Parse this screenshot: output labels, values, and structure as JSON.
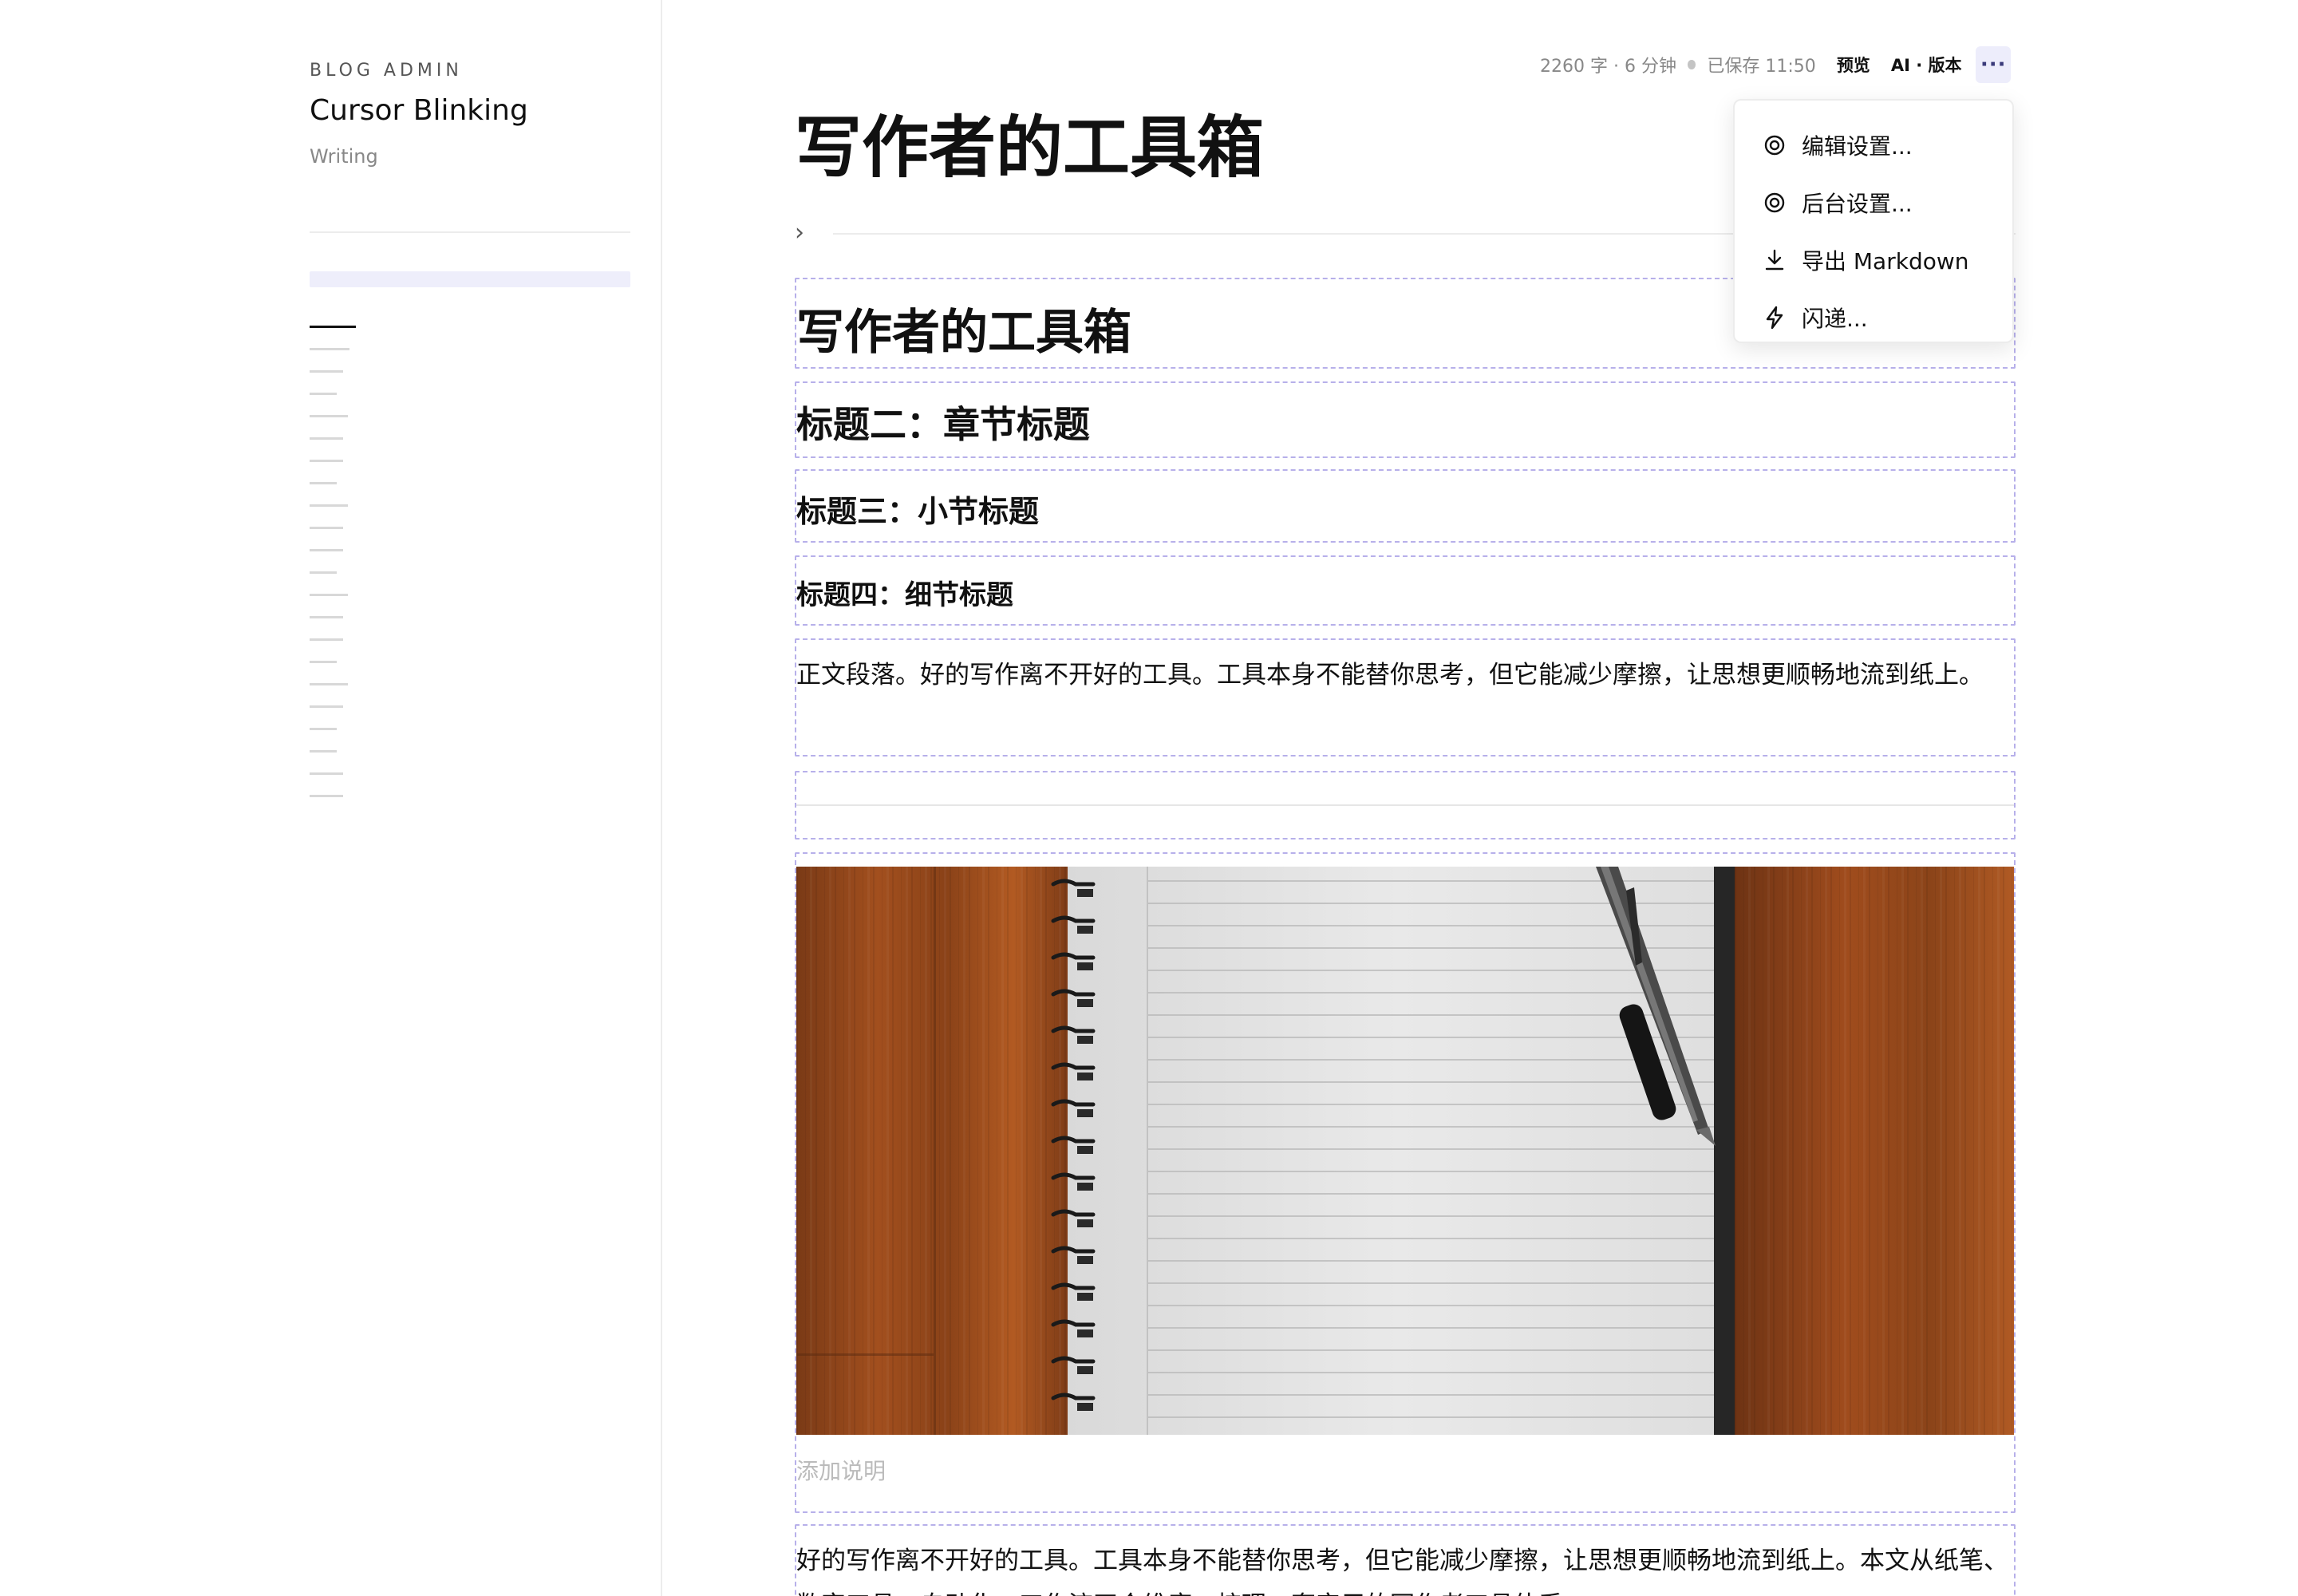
{
  "sidebar": {
    "eyebrow": "BLOG ADMIN",
    "title": "Cursor Blinking",
    "subtitle": "Writing"
  },
  "topbar": {
    "word_count": "2260 字 · 6 分钟",
    "saved": "已保存 11:50",
    "preview_label": "预览",
    "ai_version_label": "AI · 版本",
    "more_label": "···",
    "status_color": "#c4c4c4",
    "accent": "#ededfb"
  },
  "editor": {
    "doc_title": "写作者的工具箱",
    "h1": "写作者的工具箱",
    "h2": "标题二：章节标题",
    "h3": "标题三：小节标题",
    "h4": "标题四：细节标题",
    "paragraph": "正文段落。好的写作离不开好的工具。工具本身不能替你思考，但它能减少摩擦，让思想更顺畅地流到纸上。",
    "image_caption_placeholder": "添加说明",
    "paragraph2": "好的写作离不开好的工具。工具本身不能替你思考，但它能减少摩擦，让思想更顺畅地流到纸上。本文从纸笔、数字工具、自动化、工作流四个维度，梳理一套实用的写作者工具体系。"
  },
  "menu": {
    "items": [
      {
        "label": "编辑设置...",
        "icon": "gear-icon"
      },
      {
        "label": "后台设置...",
        "icon": "gear-icon"
      },
      {
        "label": "导出 Markdown",
        "icon": "download-icon"
      },
      {
        "label": "闪递...",
        "icon": "bolt-icon"
      }
    ]
  }
}
